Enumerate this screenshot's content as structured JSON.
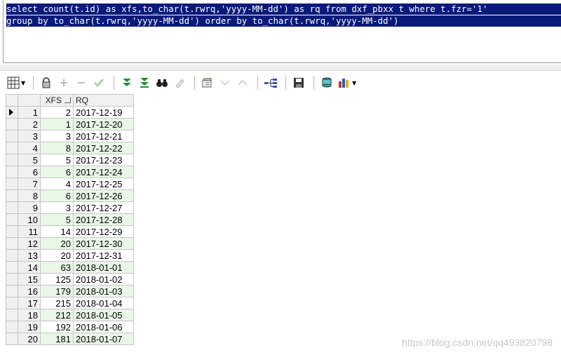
{
  "editor": {
    "sql_line1": "select count(t.id) as xfs,to_char(t.rwrq,'yyyy-MM-dd') as rq from dxf_pbxx t where t.fzr='1'",
    "sql_line2": "group by to_char(t.rwrq,'yyyy-MM-dd') order by to_char(t.rwrq,'yyyy-MM-dd')"
  },
  "toolbar": {
    "buttons": [
      "grid-icon",
      "lock-icon",
      "add-icon",
      "remove-icon",
      "check-icon",
      "fetch-next-icon",
      "fetch-all-icon",
      "find-icon",
      "clear-icon",
      "query-by-example-icon",
      "filter-down-icon",
      "filter-up-icon",
      "tree-icon",
      "save-icon",
      "export-icon",
      "chart-icon"
    ]
  },
  "grid": {
    "columns": [
      "XFS",
      "RQ"
    ],
    "rows": [
      {
        "n": "1",
        "xfs": "2",
        "rq": "2017-12-19"
      },
      {
        "n": "2",
        "xfs": "1",
        "rq": "2017-12-20"
      },
      {
        "n": "3",
        "xfs": "3",
        "rq": "2017-12-21"
      },
      {
        "n": "4",
        "xfs": "8",
        "rq": "2017-12-22"
      },
      {
        "n": "5",
        "xfs": "5",
        "rq": "2017-12-23"
      },
      {
        "n": "6",
        "xfs": "6",
        "rq": "2017-12-24"
      },
      {
        "n": "7",
        "xfs": "4",
        "rq": "2017-12-25"
      },
      {
        "n": "8",
        "xfs": "6",
        "rq": "2017-12-26"
      },
      {
        "n": "9",
        "xfs": "3",
        "rq": "2017-12-27"
      },
      {
        "n": "10",
        "xfs": "5",
        "rq": "2017-12-28"
      },
      {
        "n": "11",
        "xfs": "14",
        "rq": "2017-12-29"
      },
      {
        "n": "12",
        "xfs": "20",
        "rq": "2017-12-30"
      },
      {
        "n": "13",
        "xfs": "20",
        "rq": "2017-12-31"
      },
      {
        "n": "14",
        "xfs": "63",
        "rq": "2018-01-01"
      },
      {
        "n": "15",
        "xfs": "125",
        "rq": "2018-01-02"
      },
      {
        "n": "16",
        "xfs": "179",
        "rq": "2018-01-03"
      },
      {
        "n": "17",
        "xfs": "215",
        "rq": "2018-01-04"
      },
      {
        "n": "18",
        "xfs": "212",
        "rq": "2018-01-05"
      },
      {
        "n": "19",
        "xfs": "192",
        "rq": "2018-01-06"
      },
      {
        "n": "20",
        "xfs": "181",
        "rq": "2018-01-07"
      }
    ]
  },
  "watermark": "https://blog.csdn.net/qq493820798"
}
